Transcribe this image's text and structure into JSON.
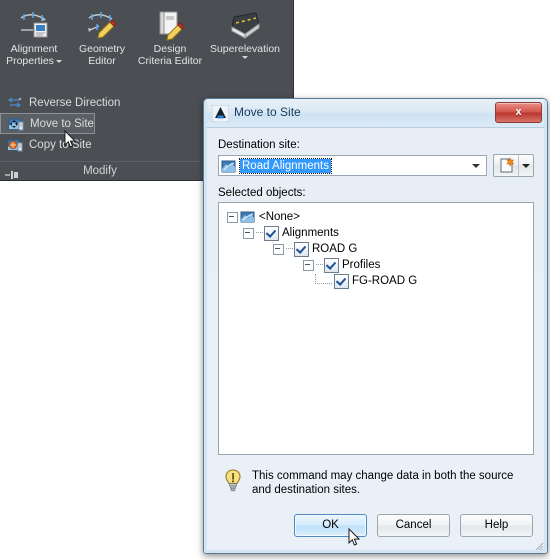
{
  "ribbon": {
    "big_buttons": [
      {
        "label_line1": "Alignment",
        "label_line2": "Properties",
        "icon": "alignment-properties-icon",
        "has_caret": true
      },
      {
        "label_line1": "Geometry",
        "label_line2": "Editor",
        "icon": "geometry-editor-icon",
        "has_caret": false
      },
      {
        "label_line1": "Design",
        "label_line2": "Criteria Editor",
        "icon": "design-criteria-editor-icon",
        "has_caret": false
      },
      {
        "label_line1": "Superelevation",
        "label_line2": "",
        "icon": "superelevation-icon",
        "has_caret": true
      }
    ],
    "commands": [
      {
        "label": "Reverse Direction",
        "icon": "reverse-direction-icon",
        "highlighted": false
      },
      {
        "label": "Move to Site",
        "icon": "move-to-site-icon",
        "highlighted": true
      },
      {
        "label": "Copy to Site",
        "icon": "copy-to-site-icon",
        "highlighted": false
      }
    ],
    "panel_title": "Modify"
  },
  "dialog": {
    "title": "Move to Site",
    "title_icon": "autocad-a-icon",
    "close_label": "x",
    "destination": {
      "label": "Destination site:",
      "value": "Road Alignments",
      "icon": "site-icon",
      "new_site_button": "new-site-button"
    },
    "selected_objects": {
      "label": "Selected objects:",
      "tree": [
        {
          "label": "<None>",
          "depth": 0,
          "type": "site",
          "checked": null,
          "expanded": true
        },
        {
          "label": "Alignments",
          "depth": 1,
          "type": "check",
          "checked": true,
          "expanded": true
        },
        {
          "label": "ROAD G",
          "depth": 2,
          "type": "check",
          "checked": true,
          "expanded": true
        },
        {
          "label": "Profiles",
          "depth": 3,
          "type": "check",
          "checked": true,
          "expanded": true
        },
        {
          "label": "FG-ROAD G",
          "depth": 4,
          "type": "check",
          "checked": true,
          "expanded": false
        }
      ]
    },
    "note": {
      "icon": "lightbulb-icon",
      "text": "This command may change data in both the source and destination sites."
    },
    "buttons": {
      "ok": "OK",
      "cancel": "Cancel",
      "help": "Help"
    }
  },
  "colors": {
    "ribbon_bg": "#4b4f53",
    "dialog_bg": "#eaf0f7",
    "selection_blue": "#3399ff",
    "close_red": "#b8352d",
    "primary_button": "#bcdff8"
  }
}
